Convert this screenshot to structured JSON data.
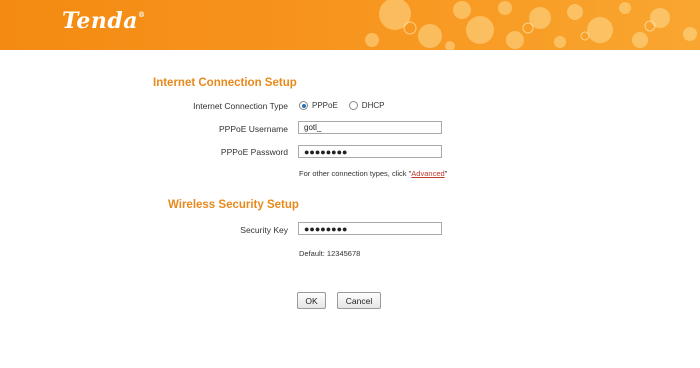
{
  "header": {
    "logo_text": "Tenda",
    "logo_mark": "®",
    "brand_color": "#f7941c"
  },
  "internet": {
    "title": "Internet Connection Setup",
    "type_label": "Internet Connection Type",
    "options": [
      {
        "label": "PPPoE",
        "selected": true
      },
      {
        "label": "DHCP",
        "selected": false
      }
    ],
    "username_label": "PPPoE Username",
    "username_value": "gotl_",
    "password_label": "PPPoE Password",
    "password_value": "●●●●●●●●",
    "hint_prefix": "For other connection types, click \"",
    "hint_link": "Advanced",
    "hint_suffix": "\""
  },
  "wireless": {
    "title": "Wireless Security Setup",
    "key_label": "Security Key",
    "key_value": "●●●●●●●●",
    "default_text": "Default: 12345678"
  },
  "buttons": {
    "ok_label": "OK",
    "cancel_label": "Cancel"
  }
}
